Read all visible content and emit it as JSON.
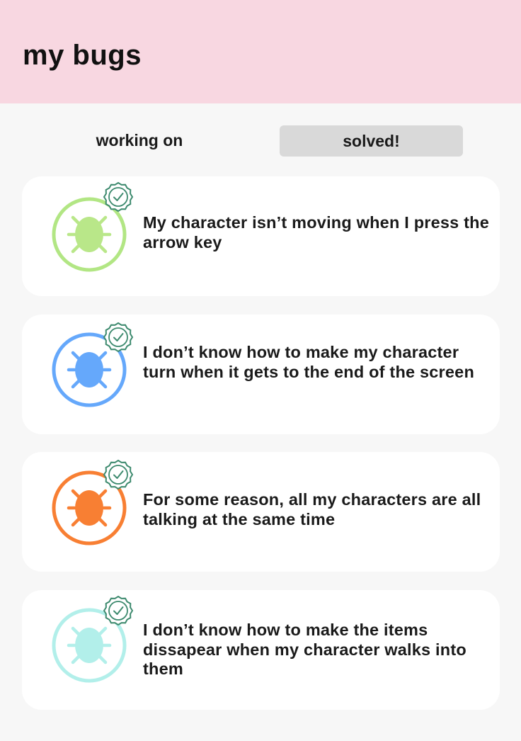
{
  "header": {
    "title": "my bugs"
  },
  "tabs": {
    "working_label": "working on",
    "solved_label": "solved!"
  },
  "colors": {
    "header_bg": "#f8d7e1",
    "active_tab_bg": "#d9d9d9",
    "check_badge": "#3d8a6e"
  },
  "bugs": [
    {
      "text": "My character isn’t moving when I press the arrow key",
      "color": "#b9e789",
      "ring": "#b2e684",
      "icon": "bug-icon",
      "status_icon": "check-badge-icon"
    },
    {
      "text": "I don’t know how to make my character turn when it gets to the end of the screen",
      "color": "#65a8fb",
      "ring": "#65a8fb",
      "icon": "bug-icon",
      "status_icon": "check-badge-icon"
    },
    {
      "text": "For some reason, all my characters are all talking at the same time",
      "color": "#f87f33",
      "ring": "#f87f33",
      "icon": "bug-icon",
      "status_icon": "check-badge-icon"
    },
    {
      "text": "I don’t know how to make the items dissapear when my character walks into them",
      "color": "#b2efea",
      "ring": "#b2efea",
      "icon": "bug-icon",
      "status_icon": "check-badge-icon"
    }
  ]
}
